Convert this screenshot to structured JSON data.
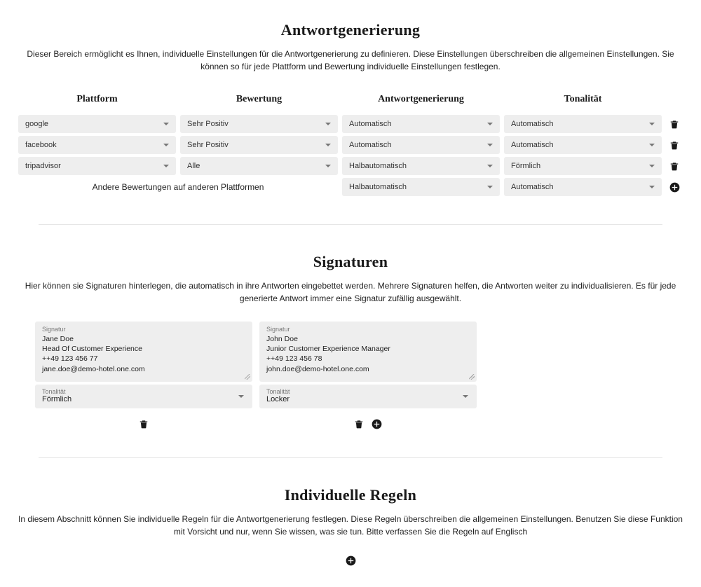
{
  "answerGen": {
    "title": "Antwortgenerierung",
    "desc": "Dieser Bereich ermöglicht es Ihnen, individuelle Einstellungen für die Antwortgenerierung zu definieren. Diese Einstellungen überschreiben die allgemeinen Einstellungen. Sie können so für jede Plattform und Bewertung individuelle Einstellungen festlegen.",
    "headers": {
      "platform": "Plattform",
      "rating": "Bewertung",
      "generation": "Antwortgenerierung",
      "tone": "Tonalität"
    },
    "rows": [
      {
        "platform": "google",
        "rating": "Sehr Positiv",
        "generation": "Automatisch",
        "tone": "Automatisch"
      },
      {
        "platform": "facebook",
        "rating": "Sehr Positiv",
        "generation": "Automatisch",
        "tone": "Automatisch"
      },
      {
        "platform": "tripadvisor",
        "rating": "Alle",
        "generation": "Halbautomatisch",
        "tone": "Förmlich"
      }
    ],
    "otherLabel": "Andere Bewertungen auf anderen Plattformen",
    "otherRow": {
      "generation": "Halbautomatisch",
      "tone": "Automatisch"
    }
  },
  "signatures": {
    "title": "Signaturen",
    "desc": "Hier können sie Signaturen hinterlegen, die automatisch in ihre Antworten eingebettet werden. Mehrere Signaturen helfen, die Antworten weiter zu individualisieren. Es für jede generierte Antwort immer eine Signatur zufällig ausgewählt.",
    "labels": {
      "signature": "Signatur",
      "tone": "Tonalität"
    },
    "items": [
      {
        "text": "Jane Doe\nHead Of Customer Experience\n++49 123 456 77\njane.doe@demo-hotel.one.com",
        "tone": "Förmlich"
      },
      {
        "text": "John Doe\nJunior Customer Experience Manager\n++49 123 456 78\njohn.doe@demo-hotel.one.com",
        "tone": "Locker"
      }
    ]
  },
  "rules": {
    "title": "Individuelle Regeln",
    "desc": "In diesem Abschnitt können Sie individuelle Regeln für die Antwortgenerierung festlegen. Diese Regeln überschreiben die allgemeinen Einstellungen. Benutzen Sie diese Funktion mit Vorsicht und nur, wenn Sie wissen, was sie tun. Bitte verfassen Sie die Regeln auf Englisch"
  }
}
